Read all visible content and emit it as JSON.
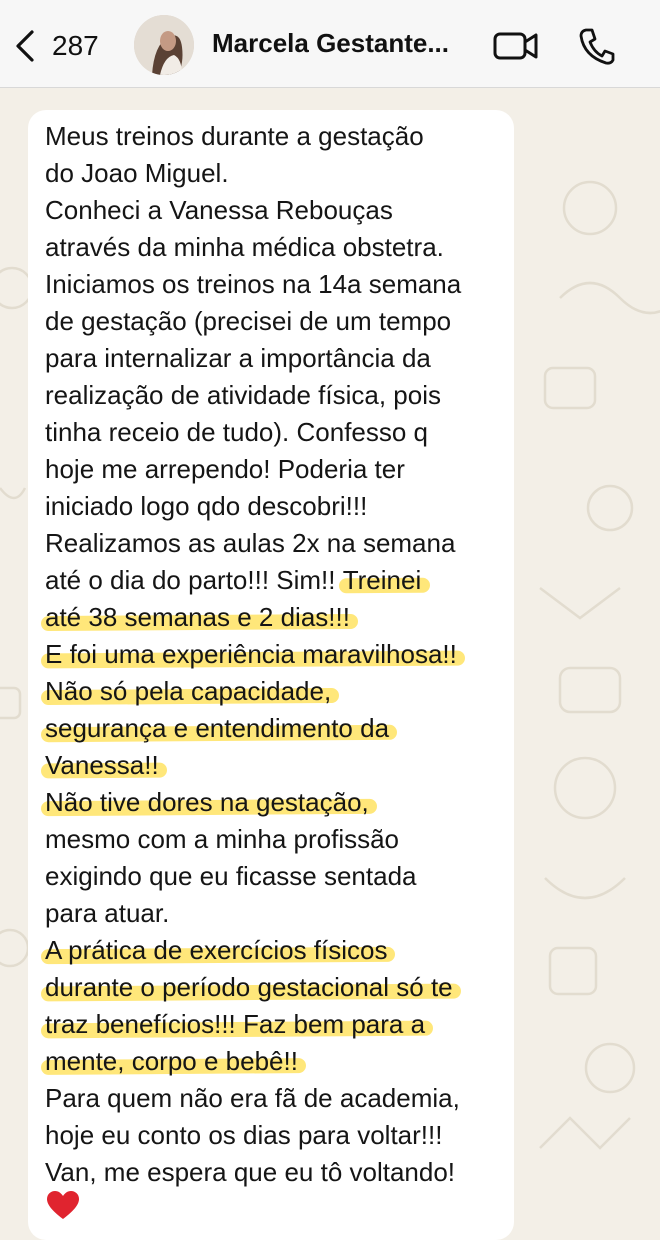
{
  "header": {
    "back_count": "287",
    "contact_name": "Marcela Gestante..."
  },
  "message": {
    "lines": [
      {
        "text": "Meus treinos durante a gestação",
        "highlight": false
      },
      {
        "text": "do Joao Miguel.",
        "highlight": false
      },
      {
        "text": "Conheci a Vanessa Rebouças",
        "highlight": false
      },
      {
        "text": "através da minha médica obstetra.",
        "highlight": false
      },
      {
        "text": "Iniciamos os treinos na 14a semana",
        "highlight": false
      },
      {
        "text": "de gestação (precisei de um tempo",
        "highlight": false
      },
      {
        "text": "para internalizar a importância da",
        "highlight": false
      },
      {
        "text": "realização de atividade física, pois",
        "highlight": false
      },
      {
        "text": "tinha receio de tudo). Confesso q",
        "highlight": false
      },
      {
        "text": "hoje me arrependo! Poderia ter",
        "highlight": false
      },
      {
        "text": "iniciado logo qdo descobri!!!",
        "highlight": false
      },
      {
        "text": "Realizamos as aulas 2x na semana",
        "highlight": false
      },
      {
        "pre": "até o dia do parto!!! Sim!! ",
        "text": "Treinei",
        "highlight": true
      },
      {
        "text": "até 38 semanas e 2 dias!!!",
        "highlight": true
      },
      {
        "text": "E foi uma experiência maravilhosa!!",
        "highlight": true
      },
      {
        "text": "Não só pela capacidade,",
        "highlight": true
      },
      {
        "text": "segurança e entendimento da",
        "highlight": true
      },
      {
        "text": "Vanessa!!",
        "highlight": true
      },
      {
        "text": "Não tive dores na gestação,",
        "highlight": true
      },
      {
        "text": "mesmo com a minha profissão",
        "highlight": false
      },
      {
        "text": "exigindo que eu ficasse sentada",
        "highlight": false
      },
      {
        "text": "para atuar.",
        "highlight": false
      },
      {
        "text": "A prática de exercícios físicos",
        "highlight": true
      },
      {
        "text": "durante o período gestacional só te",
        "highlight": true
      },
      {
        "text": "traz benefícios!!! Faz bem para a",
        "highlight": true
      },
      {
        "text": "mente, corpo e bebê!!",
        "highlight": true
      },
      {
        "text": "Para quem não era fã de academia,",
        "highlight": false
      },
      {
        "text": "hoje eu conto os dias para voltar!!!",
        "highlight": false
      },
      {
        "text": "Van, me espera que eu tô voltando!",
        "highlight": false
      }
    ],
    "emoji": "red-heart"
  },
  "colors": {
    "highlight": "#ffde46",
    "header_bg": "#f7f7f7",
    "wallpaper": "#f3efe7",
    "bubble": "#ffffff"
  }
}
